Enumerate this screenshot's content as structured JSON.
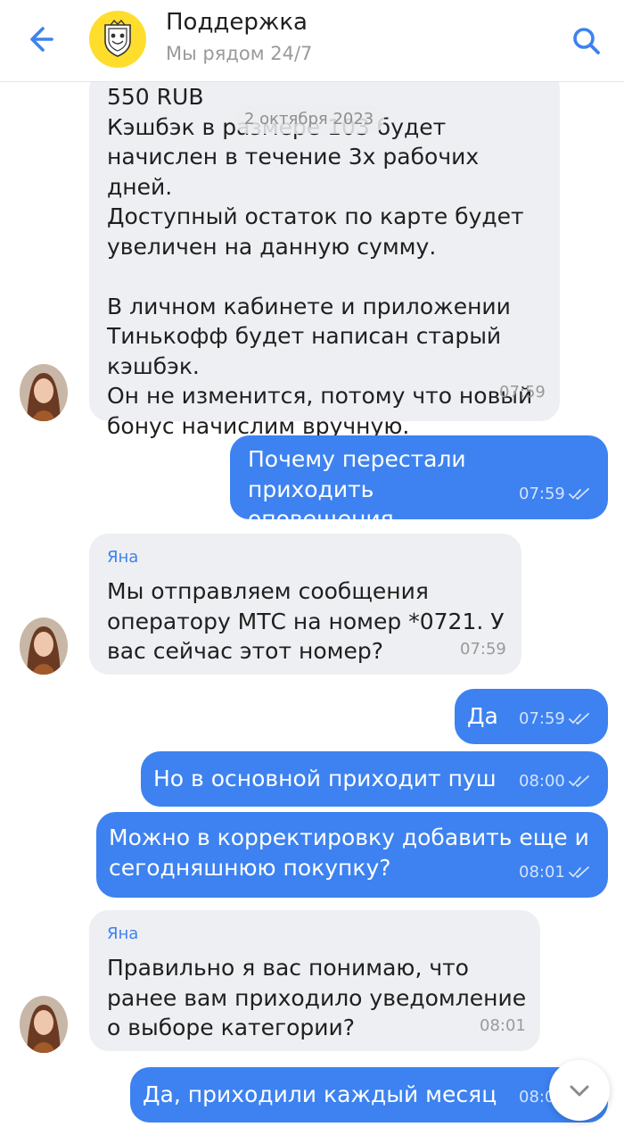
{
  "header": {
    "title": "Поддержка",
    "subtitle": "Мы рядом 24/7"
  },
  "date_chip": "2 октября 2023",
  "messages": [
    {
      "direction": "incoming",
      "text": "550 RUB\nКэшбэк в размере 103 будет\nначислен в течение 3х рабочих дней.\nДоступный остаток по карте будет\nувеличен на данную сумму.\n\nВ личном кабинете и приложении\nТинькофф будет написан старый\nкэшбэк.\nОн не изменится, потому что новый\nбонус начислим вручную.",
      "time": "07:59"
    },
    {
      "direction": "outgoing",
      "text": "Почему перестали приходить\nоповещения",
      "time": "07:59"
    },
    {
      "direction": "incoming",
      "sender": "Яна",
      "text": "Мы отправляем сообщения\nоператору МТС на номер *0721. У\nвас сейчас этот номер?",
      "time": "07:59"
    },
    {
      "direction": "outgoing",
      "text": "Да",
      "time": "07:59"
    },
    {
      "direction": "outgoing",
      "text": "Но в основной приходит пуш",
      "time": "08:00"
    },
    {
      "direction": "outgoing",
      "text": "Можно в корректировку добавить еще и\nсегодняшнюю покупку?",
      "time": "08:01"
    },
    {
      "direction": "incoming",
      "sender": "Яна",
      "text": "Правильно я вас понимаю, что\nранее вам приходило уведомление\nо выборе категории?",
      "time": "08:01"
    },
    {
      "direction": "outgoing",
      "text": "Да, приходили каждый месяц",
      "time": "08:01"
    }
  ],
  "icons": {
    "back": "arrow-left-icon",
    "search": "search-icon",
    "read": "double-check-icon",
    "scroll_down": "chevron-down-icon"
  },
  "colors": {
    "accent": "#3d82f0",
    "outgoing_bubble": "#3d82f0",
    "incoming_bubble": "#eeeff2",
    "logo": "#ffdd2d"
  }
}
